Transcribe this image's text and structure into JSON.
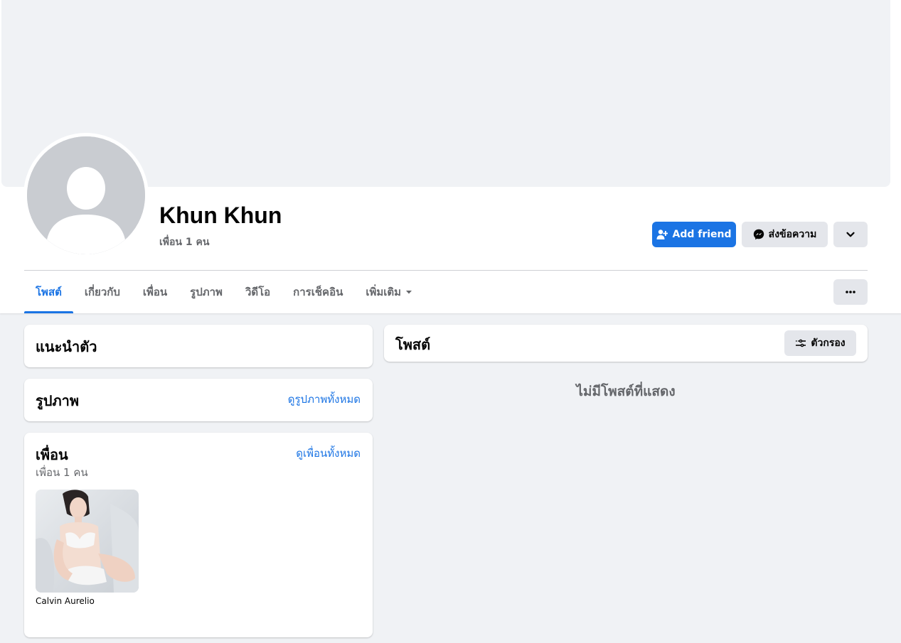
{
  "profile": {
    "name": "Khun Khun",
    "friend_count_text": "เพื่อน 1 คน"
  },
  "actions": {
    "add_friend_label": "Add friend",
    "message_label": "ส่งข้อความ"
  },
  "tabs": [
    {
      "label": "โพสต์",
      "active": true
    },
    {
      "label": "เกี่ยวกับ"
    },
    {
      "label": "เพื่อน"
    },
    {
      "label": "รูปภาพ"
    },
    {
      "label": "วิดีโอ"
    },
    {
      "label": "การเช็คอิน"
    },
    {
      "label": "เพิ่มเติม"
    }
  ],
  "intro": {
    "title": "แนะนำตัว"
  },
  "photos": {
    "title": "รูปภาพ",
    "see_all": "ดูรูปภาพทั้งหมด"
  },
  "friends": {
    "title": "เพื่อน",
    "see_all": "ดูเพื่อนทั้งหมด",
    "count_text": "เพื่อน 1 คน",
    "items": [
      {
        "name": "Calvin Aurelio"
      }
    ]
  },
  "posts": {
    "title": "โพสต์",
    "filter_label": "ตัวกรอง",
    "empty_text": "ไม่มีโพสต์ที่แสดง"
  },
  "colors": {
    "accent": "#1b74e4",
    "background": "#f0f2f5",
    "secondary_button": "#e4e6eb",
    "muted_text": "#65676b"
  },
  "icons": {
    "add_friend": "person-plus-icon",
    "message": "messenger-icon",
    "dropdown": "chevron-down-icon",
    "more": "ellipsis-icon",
    "filter": "sliders-icon",
    "tab_caret": "caret-down-icon"
  }
}
